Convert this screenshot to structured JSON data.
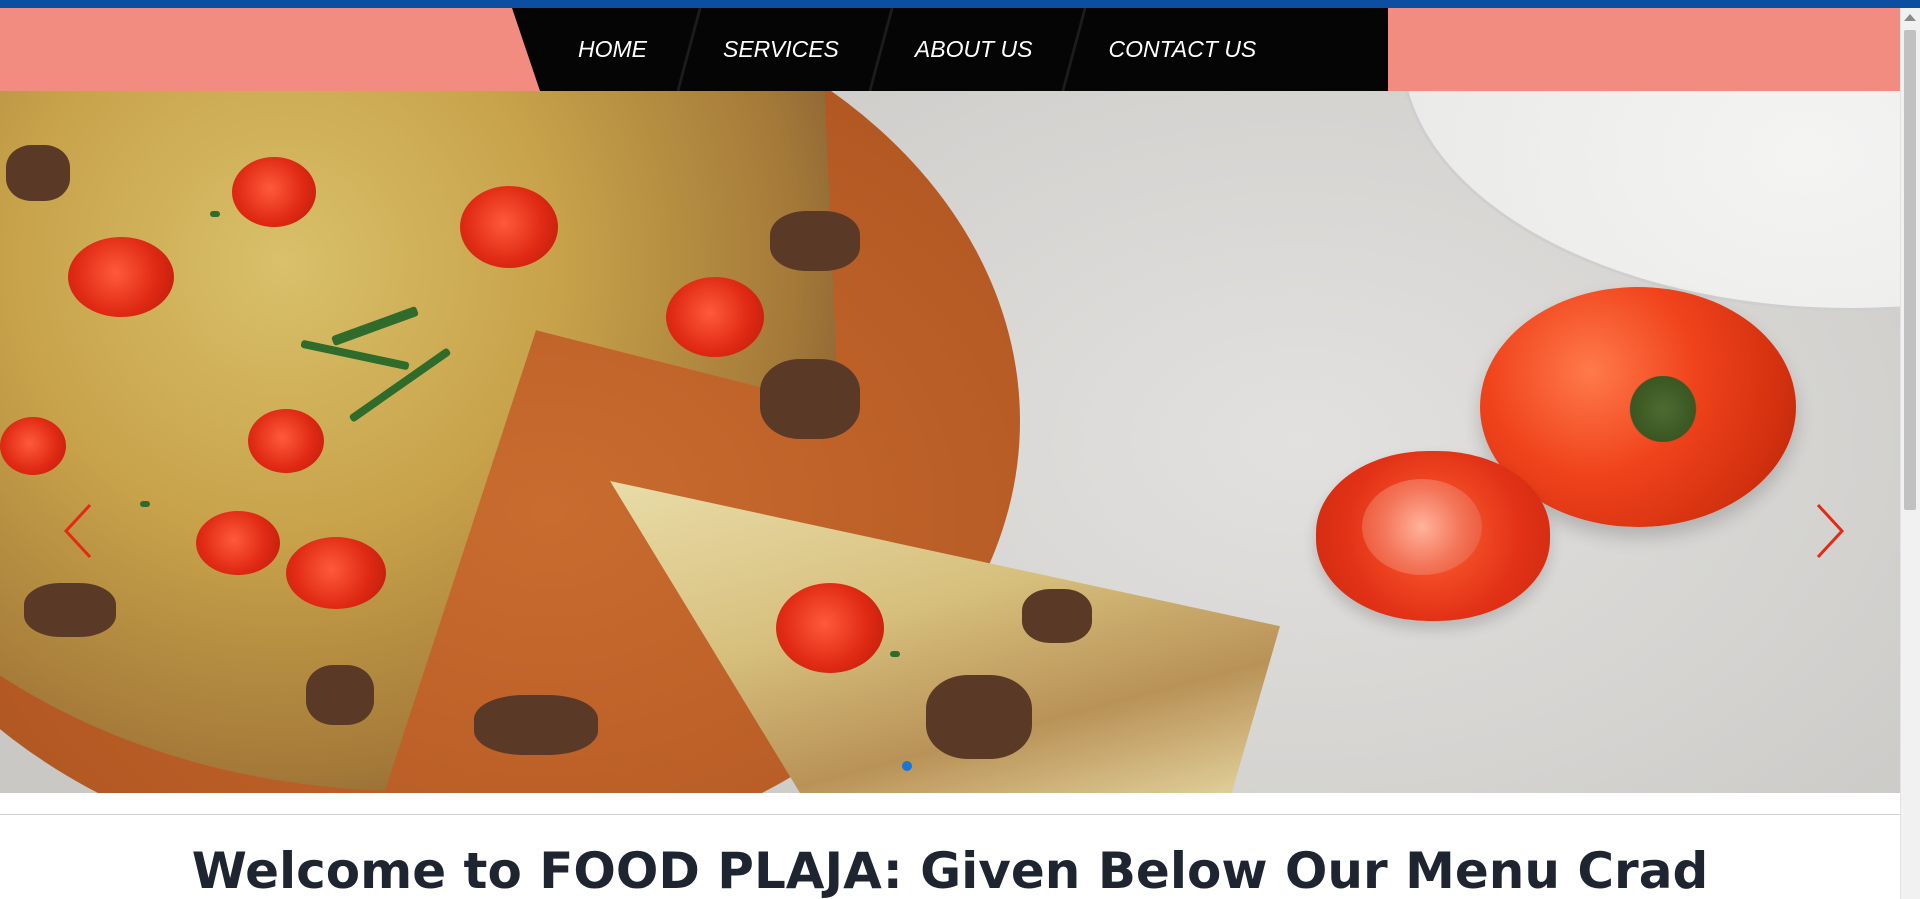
{
  "nav": {
    "items": [
      {
        "label": "HOME"
      },
      {
        "label": "SERVICES"
      },
      {
        "label": "ABOUT US"
      },
      {
        "label": "CONTACT US"
      }
    ]
  },
  "hero": {
    "image": "pizza-with-tomatoes",
    "prev_icon": "chevron-left-icon",
    "next_icon": "chevron-right-icon",
    "active_slide": 1,
    "arrow_color": "#e32a14",
    "dot_color": "#1976d2"
  },
  "main": {
    "heading": "Welcome to FOOD PLAJA: Given Below Our Menu Crad"
  },
  "colors": {
    "top_accent": "#0b4ea2",
    "nav_band": "#f28c80",
    "nav_bar": "#050505"
  }
}
